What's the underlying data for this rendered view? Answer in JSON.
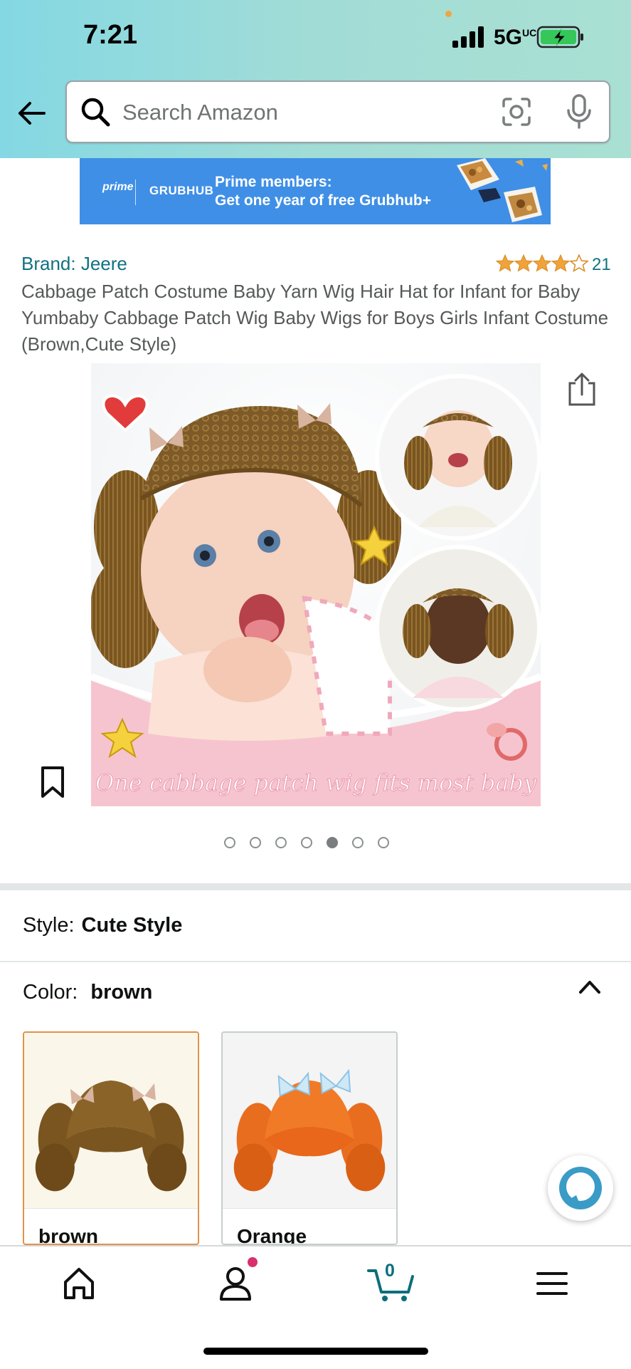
{
  "status_bar": {
    "time": "7:21",
    "network": "5G",
    "network_suffix": "UC",
    "battery_state": "charging"
  },
  "header": {
    "back_icon": "arrow-left-icon",
    "search": {
      "placeholder": "Search Amazon",
      "value": ""
    },
    "lens_icon": "camera-lens-icon",
    "mic_icon": "microphone-icon"
  },
  "banner": {
    "prime_logo": "prime",
    "partner_logo": "GRUBHUB",
    "line1": "Prime members:",
    "line2": "Get one year of free Grubhub+",
    "background": "#3f8fe6"
  },
  "product": {
    "brand": "Brand: Jeere",
    "rating_stars": 4.5,
    "rating_count": "21",
    "title": "Cabbage Patch Costume Baby Yarn Wig Hair Hat for Infant for Baby Yumbaby Cabbage Patch Wig Baby Wigs for Boys Girls Infant Costume (Brown,Cute Style)",
    "image_caption": "One cabbage patch wig fits most  baby",
    "image_count": 7,
    "current_image_index": 5
  },
  "variations": {
    "style_label": "Style:",
    "style_value": "Cute Style",
    "color_label": "Color:",
    "color_value": "brown",
    "swatches": [
      {
        "label": "brown",
        "selected": true,
        "color": "#7a5a2a"
      },
      {
        "label": "Orange",
        "selected": false,
        "color": "#e86d1f"
      }
    ]
  },
  "bottom_nav": {
    "items": [
      "home-icon",
      "profile-icon",
      "cart-icon",
      "menu-icon"
    ],
    "cart_count": "0",
    "accent": "#3c95a2"
  },
  "colors": {
    "link_teal": "#11727f",
    "star_orange": "#f0a33a",
    "selected_border": "#e0924d"
  }
}
